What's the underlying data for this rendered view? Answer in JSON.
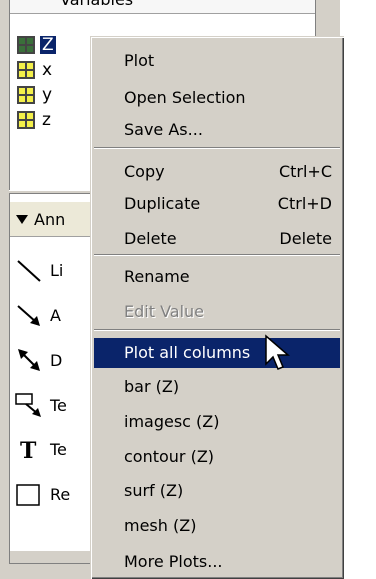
{
  "panel": {
    "top_label_fragment": "Variables",
    "variables": [
      {
        "name": "Z",
        "selected": true
      },
      {
        "name": "x",
        "selected": false
      },
      {
        "name": "y",
        "selected": false
      },
      {
        "name": "z",
        "selected": false
      }
    ],
    "annotation_header": "Ann",
    "tools": [
      {
        "label": "Li",
        "icon": "line-icon"
      },
      {
        "label": "A",
        "icon": "arrow-icon"
      },
      {
        "label": "D",
        "icon": "double-arrow-icon"
      },
      {
        "label": "Te",
        "icon": "text-arrow-icon"
      },
      {
        "label": "Te",
        "icon": "text-icon"
      },
      {
        "label": "Re",
        "icon": "rectangle-icon"
      }
    ]
  },
  "context_menu": {
    "groups": [
      [
        {
          "label": "Plot",
          "shortcut": "",
          "disabled": false
        },
        {
          "label": "Open Selection",
          "shortcut": "",
          "disabled": false
        },
        {
          "label": "Save As...",
          "shortcut": "",
          "disabled": false
        }
      ],
      [
        {
          "label": "Copy",
          "shortcut": "Ctrl+C",
          "disabled": false
        },
        {
          "label": "Duplicate",
          "shortcut": "Ctrl+D",
          "disabled": false
        },
        {
          "label": "Delete",
          "shortcut": "Delete",
          "disabled": false
        }
      ],
      [
        {
          "label": "Rename",
          "shortcut": "",
          "disabled": false
        },
        {
          "label": "Edit Value",
          "shortcut": "",
          "disabled": true
        }
      ],
      [
        {
          "label": "Plot all columns",
          "shortcut": "",
          "disabled": false,
          "highlighted": true
        },
        {
          "label": "bar (Z)",
          "shortcut": "",
          "disabled": false
        },
        {
          "label": "imagesc (Z)",
          "shortcut": "",
          "disabled": false
        },
        {
          "label": "contour (Z)",
          "shortcut": "",
          "disabled": false
        },
        {
          "label": "surf (Z)",
          "shortcut": "",
          "disabled": false
        },
        {
          "label": "mesh (Z)",
          "shortcut": "",
          "disabled": false
        },
        {
          "label": "More Plots...",
          "shortcut": "",
          "disabled": false
        }
      ]
    ]
  },
  "colors": {
    "highlight": "#0a246a",
    "face": "#d4d0c8",
    "variable_icon": "#f4f04a"
  }
}
